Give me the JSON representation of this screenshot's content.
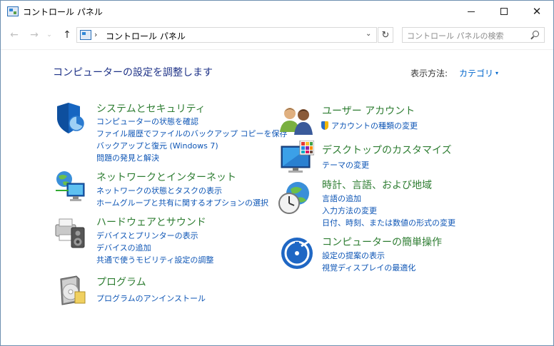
{
  "window": {
    "title": "コントロール パネル",
    "controls": {
      "minimize": "—",
      "maximize": "□",
      "close": "✕"
    }
  },
  "nav": {
    "back_icon": "←",
    "forward_icon": "→",
    "recent_icon": "⌄",
    "up_icon": "↑",
    "address_sep": "›",
    "address_crumb": "コントロール パネル",
    "address_dropdown": "⌄",
    "refresh_icon": "↻",
    "search_placeholder": "コントロール パネルの検索"
  },
  "main": {
    "heading": "コンピューターの設定を調整します",
    "view_by_label": "表示方法:",
    "view_by_value": "カテゴリ",
    "view_by_caret": "▾"
  },
  "categories_left": [
    {
      "title": "システムとセキュリティ",
      "icon": "security-shield-icon",
      "links": [
        "コンピューターの状態を確認",
        "ファイル履歴でファイルのバックアップ コピーを保存",
        "バックアップと復元 (Windows 7)",
        "問題の発見と解決"
      ]
    },
    {
      "title": "ネットワークとインターネット",
      "icon": "network-globe-icon",
      "links": [
        "ネットワークの状態とタスクの表示",
        "ホームグループと共有に関するオプションの選択"
      ]
    },
    {
      "title": "ハードウェアとサウンド",
      "icon": "printer-speaker-icon",
      "links": [
        "デバイスとプリンターの表示",
        "デバイスの追加",
        "共通で使うモビリティ設定の調整"
      ]
    },
    {
      "title": "プログラム",
      "icon": "programs-disc-icon",
      "links": [
        "プログラムのアンインストール"
      ]
    }
  ],
  "categories_right": [
    {
      "title": "ユーザー アカウント",
      "icon": "users-icon",
      "links": [
        "アカウントの種類の変更"
      ]
    },
    {
      "title": "デスクトップのカスタマイズ",
      "icon": "monitor-palette-icon",
      "links": [
        "テーマの変更"
      ]
    },
    {
      "title": "時計、言語、および地域",
      "icon": "clock-globe-icon",
      "links": [
        "言語の追加",
        "入力方法の変更",
        "日付、時刻、または数値の形式の変更"
      ]
    },
    {
      "title": "コンピューターの簡単操作",
      "icon": "ease-of-access-icon",
      "links": [
        "設定の提案の表示",
        "視覚ディスプレイの最適化"
      ]
    }
  ]
}
